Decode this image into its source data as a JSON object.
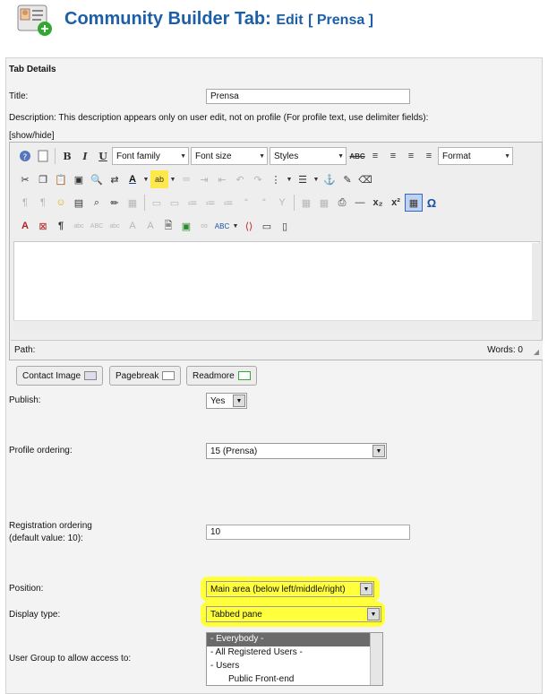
{
  "header": {
    "title_main": "Community Builder Tab:",
    "title_action": "Edit",
    "title_item": "[ Prensa ]"
  },
  "section_title": "Tab Details",
  "fields": {
    "title_label": "Title:",
    "title_value": "Prensa",
    "description_label": "Description: This description appears only on user edit, not on profile (For profile text, use delimiter fields):",
    "show_hide": "[show/hide]",
    "publish_label": "Publish:",
    "publish_value": "Yes",
    "profile_ordering_label": "Profile ordering:",
    "profile_ordering_value": "15 (Prensa)",
    "registration_ordering_label_1": "Registration ordering",
    "registration_ordering_label_2": "(default value: 10):",
    "registration_ordering_value": "10",
    "position_label": "Position:",
    "position_value": "Main area (below left/middle/right)",
    "display_type_label": "Display type:",
    "display_type_value": "Tabbed pane",
    "user_group_label": "User Group to allow access to:",
    "user_group_options": [
      "- Everybody -",
      "- All Registered Users -",
      "- Users",
      "Public Front-end"
    ],
    "user_group_selected": "- Everybody -"
  },
  "editor": {
    "font_family": "Font family",
    "font_size": "Font size",
    "styles": "Styles",
    "format": "Format",
    "path_label": "Path:",
    "words_label": "Words: 0"
  },
  "editor_buttons": {
    "contact_image": "Contact Image",
    "pagebreak": "Pagebreak",
    "readmore": "Readmore"
  },
  "colors": {
    "title_blue": "#1c5fa8",
    "highlight": "#ffff3c"
  }
}
